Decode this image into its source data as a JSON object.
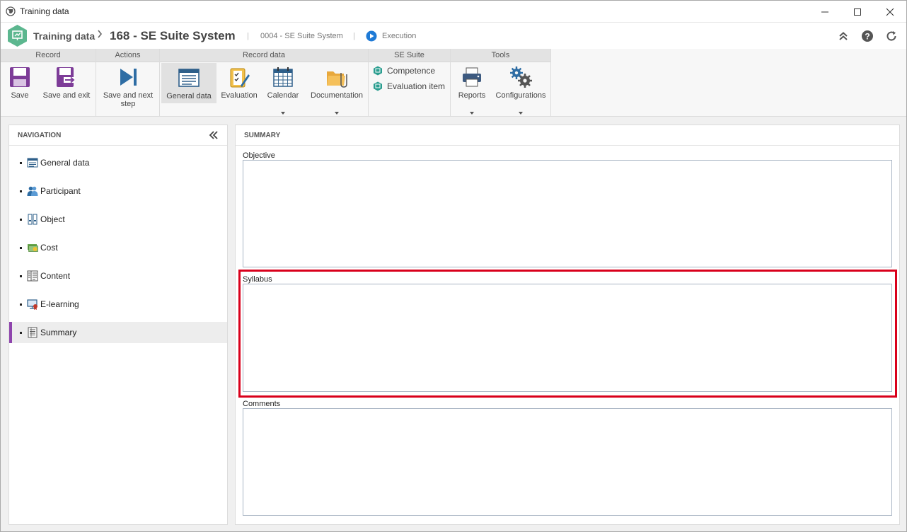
{
  "window": {
    "title": "Training data"
  },
  "header": {
    "breadcrumb": "Training data",
    "record_title": "168 - SE Suite System",
    "subtitle": "0004 - SE Suite System",
    "status": "Execution"
  },
  "ribbon": {
    "groups": {
      "record": "Record",
      "actions": "Actions",
      "record_data": "Record data",
      "se_suite": "SE Suite",
      "tools": "Tools"
    },
    "save": "Save",
    "save_exit": "Save and exit",
    "save_next": "Save and next step",
    "general_data": "General data",
    "evaluation": "Evaluation",
    "calendar": "Calendar",
    "documentation": "Documentation",
    "competence": "Competence",
    "evaluation_item": "Evaluation item",
    "reports": "Reports",
    "configurations": "Configurations"
  },
  "navigation": {
    "title": "NAVIGATION",
    "items": [
      {
        "label": "General data",
        "icon": "form-icon"
      },
      {
        "label": "Participant",
        "icon": "users-icon"
      },
      {
        "label": "Object",
        "icon": "object-icon"
      },
      {
        "label": "Cost",
        "icon": "money-icon"
      },
      {
        "label": "Content",
        "icon": "content-icon"
      },
      {
        "label": "E-learning",
        "icon": "elearning-icon"
      },
      {
        "label": "Summary",
        "icon": "summary-icon"
      }
    ],
    "active": "Summary"
  },
  "summary": {
    "title": "SUMMARY",
    "objective_label": "Objective",
    "objective_value": "",
    "syllabus_label": "Syllabus",
    "syllabus_value": "",
    "comments_label": "Comments",
    "comments_value": ""
  },
  "colors": {
    "accent": "#8e44ad",
    "highlight": "#d9001b",
    "play": "#1e7ad6"
  }
}
